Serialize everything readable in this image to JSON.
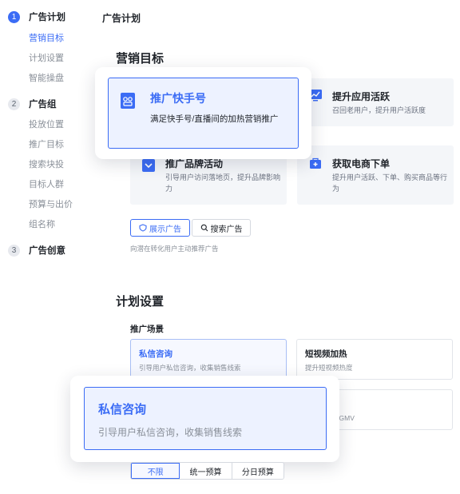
{
  "sidebar": {
    "steps": [
      {
        "num": "1",
        "title": "广告计划",
        "items": [
          "营销目标",
          "计划设置",
          "智能操盘"
        ]
      },
      {
        "num": "2",
        "title": "广告组",
        "items": [
          "投放位置",
          "推广目标",
          "搜索块投",
          "目标人群",
          "预算与出价",
          "组名称"
        ]
      },
      {
        "num": "3",
        "title": "广告创意",
        "items": []
      }
    ]
  },
  "header": {
    "title": "广告计划"
  },
  "marketing": {
    "title": "营销目标",
    "cards": [
      {
        "title": "提升应用活跃",
        "desc": "召回老用户，提升用户活跃度"
      },
      {
        "title": "推广品牌活动",
        "desc": "引导用户访问落地页，提升品牌影响力"
      },
      {
        "title": "获取电商下单",
        "desc": "提升用户活跃、下单、购买商品等行为"
      }
    ],
    "popup": {
      "title": "推广快手号",
      "desc": "满足快手号/直播间的加热营销推广"
    },
    "tabs": [
      "展示广告",
      "搜索广告"
    ],
    "hint": "向潜在转化用户主动推荐广告"
  },
  "plan": {
    "title": "计划设置",
    "scene_label": "推广场景",
    "scenes": [
      {
        "title": "私信咨询",
        "desc": "引导用户私信咨询，收集销售线索"
      },
      {
        "title": "短视频加热",
        "desc": "提升短视频热度"
      },
      {
        "title": "",
        "desc": "升付费小说GMV"
      }
    ],
    "popup": {
      "title": "私信咨询",
      "desc": "引导用户私信咨询，收集销售线索"
    },
    "budget_options": [
      "不限",
      "统一预算",
      "分日预算"
    ]
  },
  "colors": {
    "accent": "#3b6cf5",
    "card_bg": "#f4f6f9"
  }
}
